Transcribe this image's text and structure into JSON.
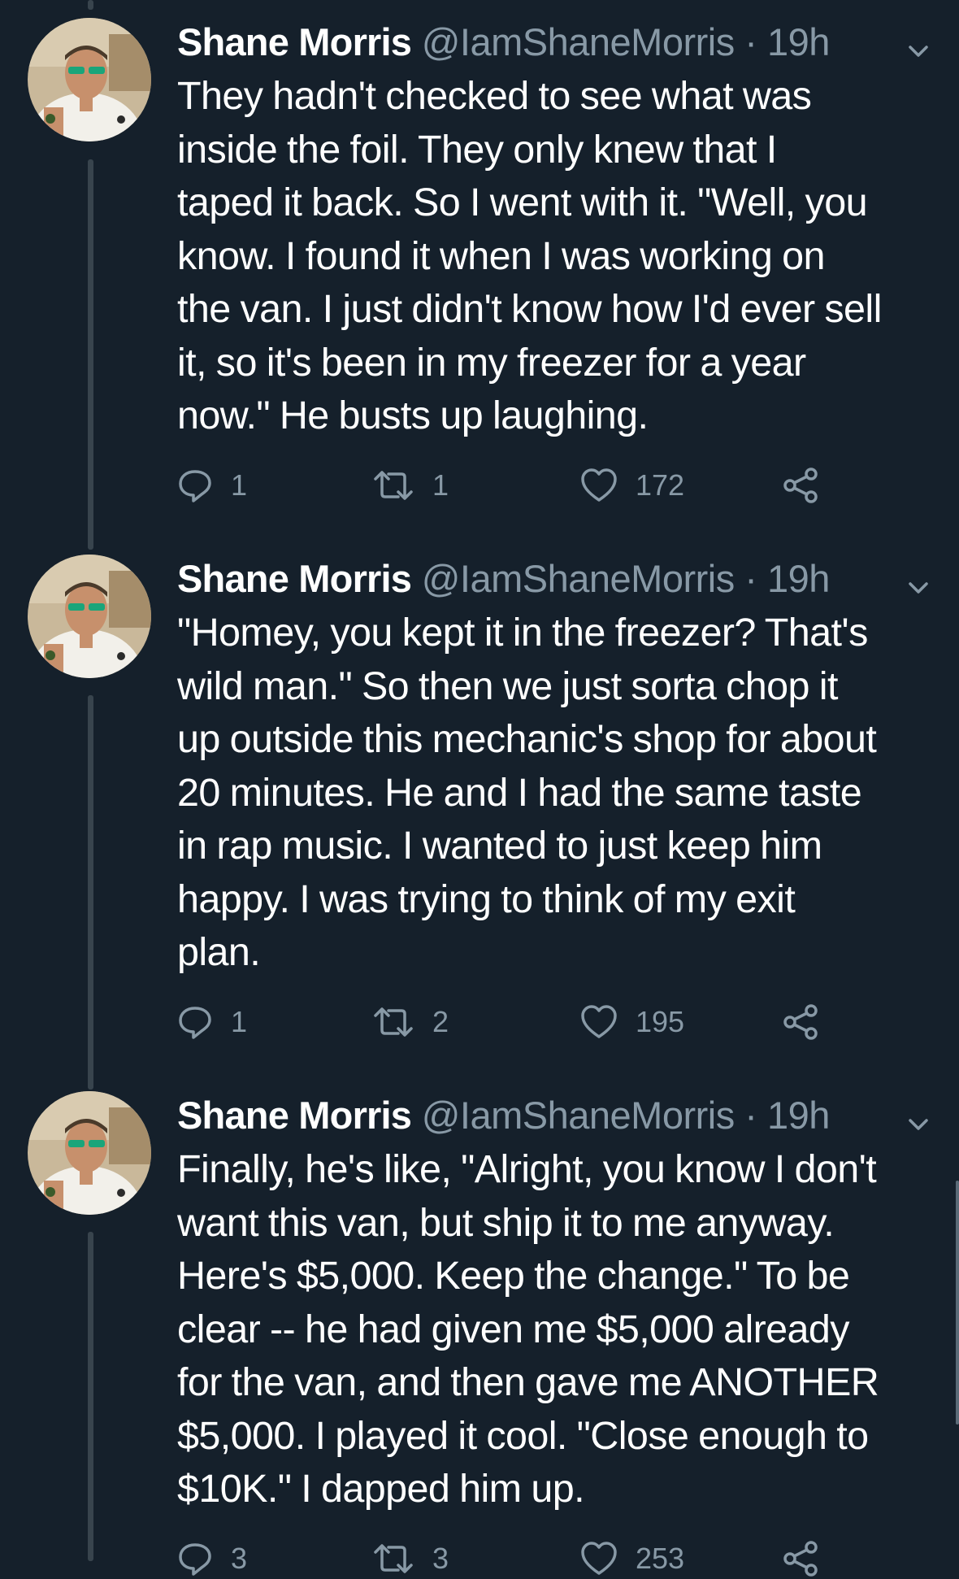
{
  "tweets": [
    {
      "name": "Shane Morris",
      "handle": "@IamShaneMorris",
      "separator": "·",
      "time": "19h",
      "text": "They hadn't checked to see what was\ninside the foil. They only knew that I\ntaped it back. So I went with it. \"Well, you\nknow. I found it when I was working on\nthe van. I just didn't know how I'd ever sell\nit, so it's been in my freezer for a year\nnow.\" He busts up laughing.",
      "replies": "1",
      "retweets": "1",
      "likes": "172"
    },
    {
      "name": "Shane Morris",
      "handle": "@IamShaneMorris",
      "separator": "·",
      "time": "19h",
      "text": "\"Homey, you kept it in the freezer? That's\nwild man.\" So then we just sorta chop it\nup outside this mechanic's shop for about\n20 minutes. He and I had the same taste\nin rap music. I wanted to just keep him\nhappy. I was trying to think of my exit\nplan.",
      "replies": "1",
      "retweets": "2",
      "likes": "195"
    },
    {
      "name": "Shane Morris",
      "handle": "@IamShaneMorris",
      "separator": "·",
      "time": "19h",
      "text": "Finally, he's like, \"Alright, you know I don't\nwant this van, but ship it to me anyway.\nHere's $5,000. Keep the change.\" To be\nclear -- he had given me $5,000 already\nfor the van, and then gave me ANOTHER\n$5,000. I played it cool. \"Close enough to\n$10K.\" I dapped him up.",
      "replies": "3",
      "retweets": "3",
      "likes": "253"
    }
  ],
  "icons": {
    "reply": "reply-icon",
    "retweet": "retweet-icon",
    "like": "heart-icon",
    "share": "share-icon",
    "more": "chevron-down-icon"
  },
  "colors": {
    "background": "#15202b",
    "text": "#ffffff",
    "secondary": "#8899a6",
    "thread_line": "#38444d"
  }
}
